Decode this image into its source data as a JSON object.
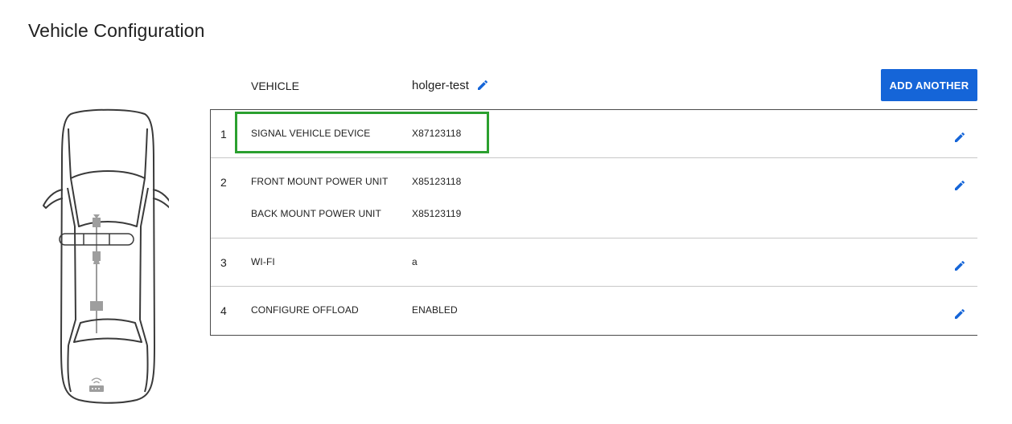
{
  "page": {
    "title": "Vehicle Configuration"
  },
  "vehicle": {
    "label": "VEHICLE",
    "name": "holger-test",
    "add_button_label": "ADD ANOTHER"
  },
  "config_rows": [
    {
      "number": "1",
      "entries": [
        {
          "label": "SIGNAL VEHICLE DEVICE",
          "value": "X87123118"
        }
      ],
      "highlighted": true
    },
    {
      "number": "2",
      "entries": [
        {
          "label": "FRONT MOUNT POWER UNIT",
          "value": "X85123118"
        },
        {
          "label": "BACK MOUNT POWER UNIT",
          "value": "X85123119"
        }
      ]
    },
    {
      "number": "3",
      "entries": [
        {
          "label": "WI-FI",
          "value": "a"
        }
      ]
    },
    {
      "number": "4",
      "entries": [
        {
          "label": "CONFIGURE OFFLOAD",
          "value": "ENABLED"
        }
      ]
    }
  ],
  "icons": {
    "edit": "pencil-icon",
    "car": "car-top-view-icon",
    "device": "device-icon",
    "wifi": "wifi-router-icon"
  },
  "colors": {
    "accent": "#1565d8",
    "highlight": "#2ba02f",
    "device_gray": "#9e9e9e"
  }
}
